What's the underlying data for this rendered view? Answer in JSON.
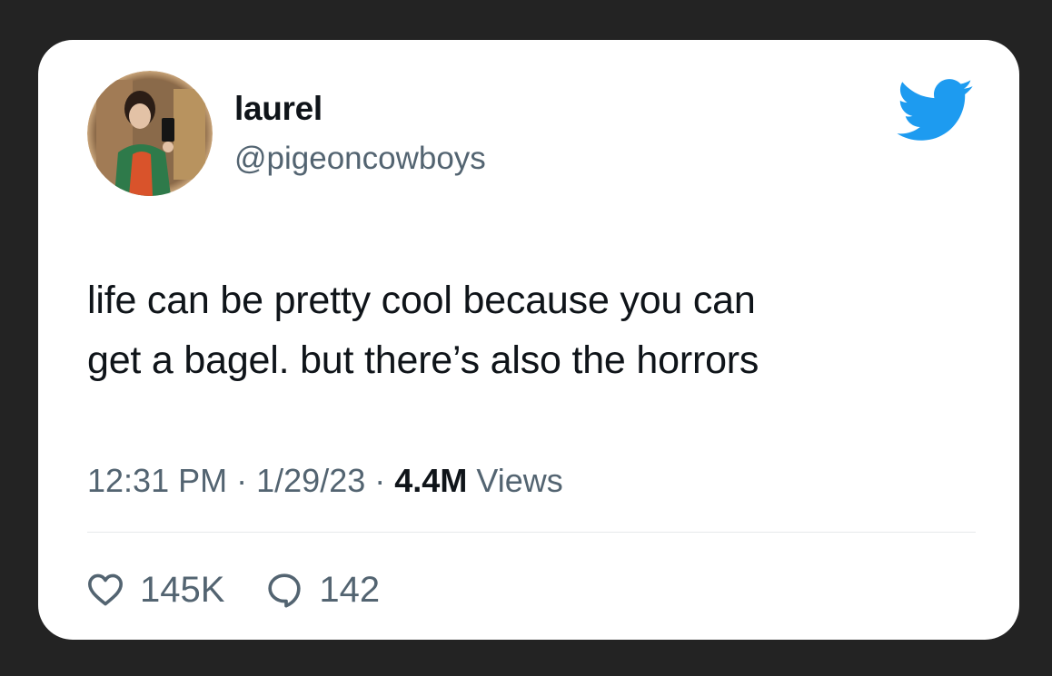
{
  "user": {
    "display_name": "laurel",
    "handle": "@pigeoncowboys"
  },
  "tweet": {
    "text_lines": [
      "life can be pretty cool because you can",
      "get a bagel. but there’s also the horrors"
    ],
    "time": "12:31 PM",
    "date": "1/29/23",
    "separator": "·",
    "views_count": "4.4M",
    "views_label": "Views"
  },
  "actions": {
    "likes": "145K",
    "replies": "142"
  },
  "colors": {
    "background": "#232323",
    "card": "#ffffff",
    "text_primary": "#0f1419",
    "text_secondary": "#536471",
    "twitter_blue": "#1d9bf0"
  },
  "icons": {
    "brand": "twitter-bird-icon",
    "like": "heart-icon",
    "reply": "speech-bubble-icon"
  }
}
